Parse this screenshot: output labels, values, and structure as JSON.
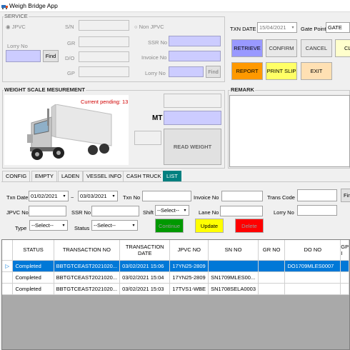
{
  "app": {
    "title": "Weigh Bridge App"
  },
  "service": {
    "group_title": "SERVICE",
    "jpvc_radio": "JPVC",
    "non_jpvc_radio": "Non JPVC",
    "lorry_no_label": "Lorry No",
    "find_label": "Find",
    "sn_label": "S/N",
    "gr_label": "GR",
    "do_label": "D/O",
    "gp_label": "GP",
    "ssr_no_label": "SSR No",
    "invoice_no_label": "Invoice No",
    "lorry_no2_label": "Lorry No",
    "find2_label": "Find"
  },
  "top_right": {
    "txn_date_label": "TXN DATE",
    "txn_date_value": "15/04/2021",
    "gate_point_label": "Gate Point",
    "gate_point_value": "GATE",
    "retrieve": "RETRIEVE",
    "confirm": "CONFIRM",
    "cancel": "CANCEL",
    "clear": "CL",
    "report": "REPORT",
    "print_slip": "PRINT SLIP",
    "exit": "EXIT"
  },
  "weight": {
    "group_title": "WEIGHT SCALE MESUREMENT",
    "current_pending": "Current pending: 13",
    "mt_label": "MT",
    "read_weight": "READ WEIGHT"
  },
  "remark": {
    "group_title": "REMARK"
  },
  "tabs": [
    "CONFIG",
    "EMPTY",
    "LADEN",
    "VESSEL INFO",
    "CASH TRUCK",
    "LIST"
  ],
  "filters": {
    "txn_date_label": "Txn Date",
    "date_from": "01/02/2021",
    "tilde": "~",
    "date_to": "03/03/2021",
    "txn_no_label": "Txn No",
    "invoice_no_label": "Invoice No",
    "trans_code_label": "Trans Code",
    "find_label": "Fin",
    "jpvc_no_label": "JPVC No",
    "ssr_no_label": "SSR No",
    "shift_label": "Shift",
    "shift_value": "--Select--",
    "lane_no_label": "Lane No",
    "lorry_no_label": "Lorry No",
    "type_label": "Type",
    "type_value": "--Select--",
    "status_label": "Status",
    "status_value": "--Select--",
    "continue": "Continue",
    "update": "Update",
    "delete": "Delete",
    "colors": {
      "continue": "#009900",
      "update": "#ffff00",
      "delete": "#ff0000"
    }
  },
  "grid": {
    "columns": [
      "STATUS",
      "TRANSACTION NO",
      "TRANSACTION DATE",
      "JPVC NO",
      "SN NO",
      "GR NO",
      "DO NO",
      "GP I"
    ],
    "rows": [
      [
        "Completed",
        "BBTGTCEAST2021020...",
        "03/02/2021 15:06",
        "17YN25-2809",
        "",
        "",
        "DO1709MLES0007",
        ""
      ],
      [
        "Completed",
        "BBTGTCEAST2021020...",
        "03/02/2021 15:04",
        "17YN25-2809",
        "SN1709MLES00...",
        "",
        "",
        ""
      ],
      [
        "Completed",
        "BBTGTCEAST2021020...",
        "03/02/2021 15:03",
        "17TVS1-WBE",
        "SN1708SELA0003",
        "",
        "",
        ""
      ]
    ],
    "selected_row": 0
  }
}
